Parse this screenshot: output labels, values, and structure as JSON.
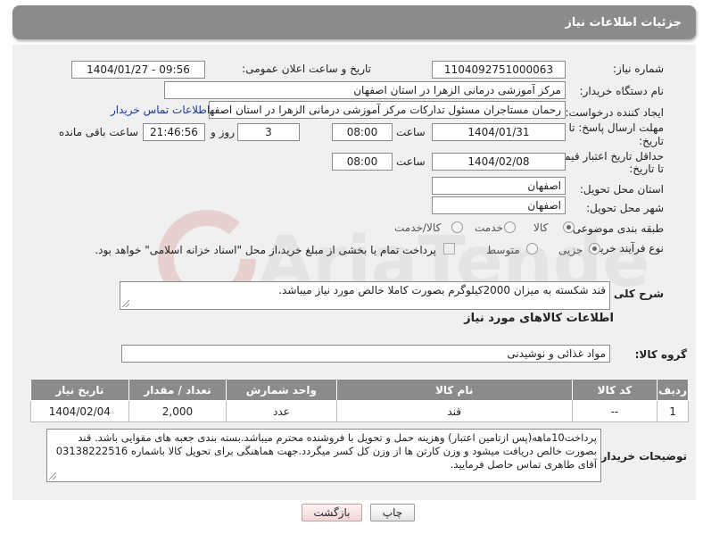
{
  "header": {
    "title": "جزئیات اطلاعات نیاز"
  },
  "fields": {
    "need_number": {
      "label": "شماره نیاز:",
      "value": "1104092751000063"
    },
    "announce_datetime": {
      "label": "تاریخ و ساعت اعلان عمومی:",
      "value": "1404/01/27 - 09:56"
    },
    "buyer_org": {
      "label": "نام دستگاه خریدار:",
      "value": "مرکز آموزشی درمانی الزهرا در استان اصفهان"
    },
    "requester": {
      "label": "ایجاد کننده درخواست:",
      "value": "رحمان مستاجران مسئول تدارکات مرکز آموزشی درمانی الزهرا در استان اصفهان",
      "contact_link": "اطلاعات تماس خریدار"
    },
    "reply_deadline": {
      "label_line1": "مهلت ارسال پاسخ: تا",
      "label_line2": "تاریخ:",
      "date": "1404/01/31",
      "time_label": "ساعت",
      "time": "08:00",
      "days": "3",
      "days_label": "روز و",
      "remaining": "21:46:56",
      "remaining_label": "ساعت باقی مانده"
    },
    "price_validity": {
      "label_line1": "حداقل تاریخ اعتبار قیمت:",
      "label_line2": "تا تاریخ:",
      "date": "1404/02/08",
      "time_label": "ساعت",
      "time": "08:00"
    },
    "delivery_province": {
      "label": "استان محل تحویل:",
      "value": "اصفهان"
    },
    "delivery_city": {
      "label": "شهر محل تحویل:",
      "value": "اصفهان"
    },
    "subject_category": {
      "label": "طبقه بندی موضوعی:",
      "options": [
        "کالا",
        "خدمت",
        "کالا/خدمت"
      ],
      "selected": "کالا"
    },
    "purchase_process": {
      "label": "نوع فرآیند خرید :",
      "options": [
        "جزیی",
        "متوسط"
      ],
      "selected": "جزیی",
      "payment_note": "پرداخت تمام یا بخشی از مبلغ خرید،از محل \"اسناد خزانه اسلامی\" خواهد بود."
    }
  },
  "description": {
    "label": "شرح کلی نیاز:",
    "value": "قند شکسته به میزان 2000کیلوگرم بصورت کاملا خالص مورد نیاز میباشد."
  },
  "goods_section": {
    "title": "اطلاعات کالاهای مورد نیاز",
    "group_label": "گروه کالا:",
    "group_value": "مواد غذائی و نوشیدنی",
    "columns": [
      "ردیف",
      "کد کالا",
      "نام کالا",
      "واحد شمارش",
      "تعداد / مقدار",
      "تاریخ نیاز"
    ],
    "rows": [
      {
        "row": "1",
        "code": "--",
        "name": "قند",
        "unit": "عدد",
        "qty": "2,000",
        "date": "1404/02/04"
      }
    ]
  },
  "buyer_notes": {
    "label": "توضیحات خریدار:",
    "lines": [
      "پرداخت10ماهه(پس ازتامین اعتبار) وهزینه حمل و تحویل با فروشنده محترم میباشد.بسته بندی جعبه های مقوایی باشد. قند",
      "بصورت خالص دریافت میشود و وزن کارتن ها از وزن کل کسر میگردد.جهت هماهنگی برای تحویل کالا باشماره 03138222516",
      "آقای طاهری تماس حاصل فرمایید."
    ]
  },
  "buttons": {
    "print": "چاپ",
    "back": "بازگشت"
  },
  "watermark": {
    "text": "AriaTender.net"
  }
}
